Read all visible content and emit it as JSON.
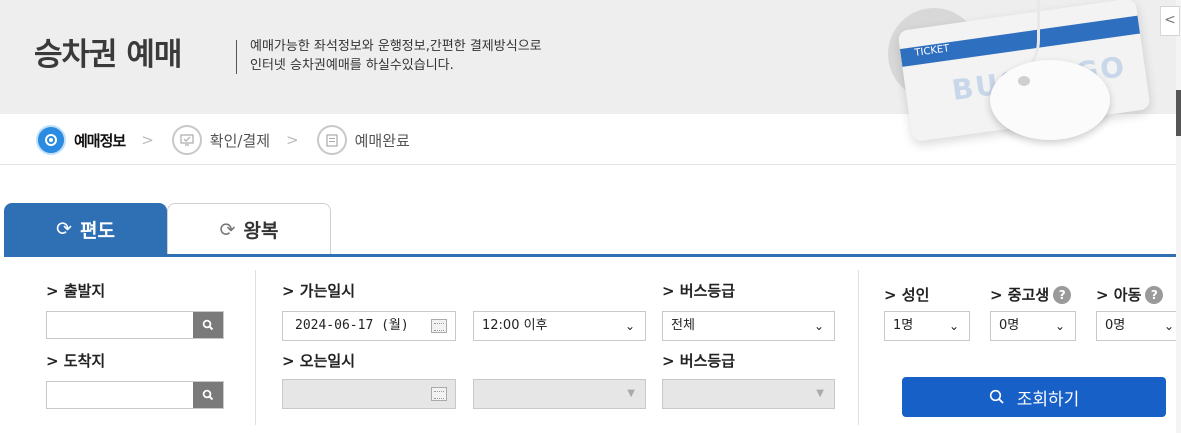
{
  "header": {
    "title": "승차권 예매",
    "desc_line1": "예매가능한 좌석정보와 운행정보,간편한 결제방식으로",
    "desc_line2": "인터넷 승차권예매를 하실수있습니다.",
    "ticket_label": "TICKET",
    "ticket_brand": "BUS TAGO",
    "collapse_glyph": "<"
  },
  "steps": [
    {
      "label": "예매정보",
      "icon": "map-pin-icon",
      "active": true
    },
    {
      "label": "확인/결제",
      "icon": "check-screen-icon",
      "active": false
    },
    {
      "label": "예매완료",
      "icon": "document-icon",
      "active": false
    }
  ],
  "step_arrow": ">",
  "tabs": {
    "oneway": "편도",
    "round": "왕복",
    "icon_glyph": "⟳"
  },
  "form": {
    "departure_label": "> 출발지",
    "arrival_label": "> 도착지",
    "departure_value": "",
    "arrival_value": "",
    "go_date_label": "> 가는일시",
    "return_date_label": "> 오는일시",
    "go_date": "2024-06-17 (월)",
    "go_time": "12:00 이후",
    "bus_class_label_go": "> 버스등급",
    "bus_class_label_return": "> 버스등급",
    "bus_class_go": "전체",
    "adult_label": "> 성인",
    "teen_label": "> 중고생",
    "child_label": "> 아동",
    "adult_value": "1명",
    "teen_value": "0명",
    "child_value": "0명",
    "help_glyph": "?",
    "submit_label": "조회하기"
  },
  "colors": {
    "accent": "#2f6fb4",
    "button": "#1660c8",
    "active_step": "#2b8be0"
  }
}
